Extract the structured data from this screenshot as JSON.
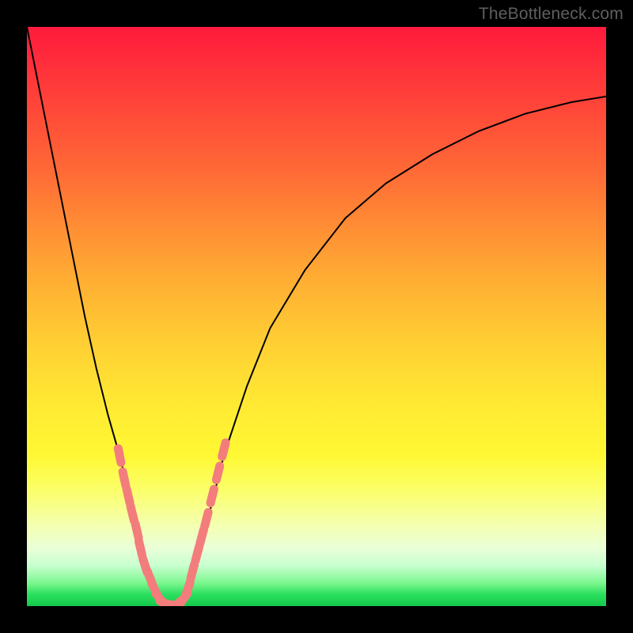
{
  "watermark": "TheBottleneck.com",
  "chart_data": {
    "type": "line",
    "title": "",
    "xlabel": "",
    "ylabel": "",
    "xlim": [
      0,
      100
    ],
    "ylim": [
      0,
      100
    ],
    "grid": false,
    "legend": false,
    "background": {
      "type": "vertical-gradient",
      "stops": [
        {
          "pos": 0.0,
          "color": "#ff1a3c"
        },
        {
          "pos": 0.1,
          "color": "#ff3a3a"
        },
        {
          "pos": 0.25,
          "color": "#ff6a36"
        },
        {
          "pos": 0.35,
          "color": "#ff8f34"
        },
        {
          "pos": 0.45,
          "color": "#ffb233"
        },
        {
          "pos": 0.55,
          "color": "#ffd033"
        },
        {
          "pos": 0.65,
          "color": "#ffe933"
        },
        {
          "pos": 0.74,
          "color": "#fff833"
        },
        {
          "pos": 0.8,
          "color": "#fbff6a"
        },
        {
          "pos": 0.86,
          "color": "#f4ffb0"
        },
        {
          "pos": 0.9,
          "color": "#eaffd8"
        },
        {
          "pos": 0.93,
          "color": "#c8ffcf"
        },
        {
          "pos": 0.96,
          "color": "#7cf78f"
        },
        {
          "pos": 0.98,
          "color": "#2bdf5e"
        },
        {
          "pos": 1.0,
          "color": "#14c94a"
        }
      ]
    },
    "series": [
      {
        "name": "bottleneck-curve",
        "color": "#000000",
        "stroke_width": 2,
        "x": [
          0,
          2,
          4,
          6,
          8,
          10,
          12,
          14,
          16,
          17,
          18,
          19,
          20,
          21,
          22,
          23,
          24,
          25,
          26,
          27,
          28,
          29,
          30,
          32,
          34,
          38,
          42,
          48,
          55,
          62,
          70,
          78,
          86,
          94,
          100
        ],
        "y": [
          100,
          90,
          80,
          70,
          60,
          50,
          41,
          33,
          26,
          22,
          18,
          14,
          10,
          6,
          3,
          1,
          0,
          0,
          0,
          1,
          3,
          6,
          10,
          18,
          26,
          38,
          48,
          58,
          67,
          73,
          78,
          82,
          85,
          87,
          88
        ]
      }
    ],
    "markers": [
      {
        "name": "salmon-dots-left",
        "color": "#f37d7d",
        "shape": "rounded-capsule",
        "points": [
          {
            "x": 16.0,
            "y": 26
          },
          {
            "x": 16.8,
            "y": 22
          },
          {
            "x": 17.5,
            "y": 19
          },
          {
            "x": 18.2,
            "y": 16
          },
          {
            "x": 19.0,
            "y": 13
          },
          {
            "x": 19.6,
            "y": 10
          },
          {
            "x": 20.4,
            "y": 7
          },
          {
            "x": 21.2,
            "y": 5
          },
          {
            "x": 22.0,
            "y": 3
          },
          {
            "x": 23.0,
            "y": 1.2
          },
          {
            "x": 24.0,
            "y": 0.4
          },
          {
            "x": 25.0,
            "y": 0.2
          }
        ]
      },
      {
        "name": "salmon-dots-right",
        "color": "#f37d7d",
        "shape": "rounded-capsule",
        "points": [
          {
            "x": 26.0,
            "y": 0.4
          },
          {
            "x": 27.0,
            "y": 1.2
          },
          {
            "x": 27.8,
            "y": 3
          },
          {
            "x": 28.6,
            "y": 6
          },
          {
            "x": 29.4,
            "y": 9
          },
          {
            "x": 30.2,
            "y": 12
          },
          {
            "x": 31.0,
            "y": 15
          },
          {
            "x": 32.0,
            "y": 19
          },
          {
            "x": 33.0,
            "y": 23
          },
          {
            "x": 34.0,
            "y": 27
          }
        ]
      }
    ]
  }
}
